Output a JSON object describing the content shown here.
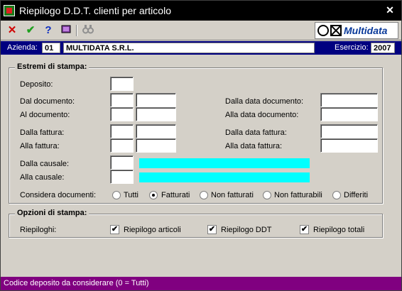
{
  "window": {
    "title": "Riepilogo D.D.T. clienti per articolo"
  },
  "toolbar": {
    "icons": [
      "cancel-icon",
      "confirm-icon",
      "help-icon",
      "book-icon",
      "binoculars-icon"
    ],
    "cancel": "✕",
    "confirm": "✔",
    "help": "?",
    "book": "📖",
    "search": "👓"
  },
  "logo": {
    "text": "Multidata"
  },
  "azienda": {
    "label": "Azienda:",
    "code": "01",
    "name": "MULTIDATA S.R.L.",
    "esercizio_label": "Esercizio:",
    "esercizio": "2007"
  },
  "estremi": {
    "title": "Estremi di stampa:",
    "deposito": "Deposito:",
    "dal_documento": "Dal documento:",
    "al_documento": "Al documento:",
    "dalla_fattura": "Dalla fattura:",
    "alla_fattura": "Alla fattura:",
    "dalla_causale": "Dalla causale:",
    "alla_causale": "Alla causale:",
    "dalla_data_documento": "Dalla data documento:",
    "alla_data_documento": "Alla data documento:",
    "dalla_data_fattura": "Dalla data fattura:",
    "alla_data_fattura": "Alla data fattura:",
    "considera_label": "Considera documenti:",
    "considera_options": [
      "Tutti",
      "Fatturati",
      "Non fatturati",
      "Non fatturabili",
      "Differiti"
    ],
    "considera_selected": "Fatturati"
  },
  "opzioni": {
    "title": "Opzioni di stampa:",
    "riepiloghi_label": "Riepiloghi:",
    "articoli": "Riepilogo articoli",
    "ddt": "Riepilogo DDT",
    "totali": "Riepilogo totali",
    "check_mark": "✔"
  },
  "status": {
    "text": "Codice deposito da considerare (0 = Tutti)"
  },
  "colors": {
    "titlebar": "#000000",
    "azienda_bar": "#000080",
    "statusbar": "#800080",
    "causale_field": "#00ffff",
    "window_bg": "#d4d0c8"
  }
}
